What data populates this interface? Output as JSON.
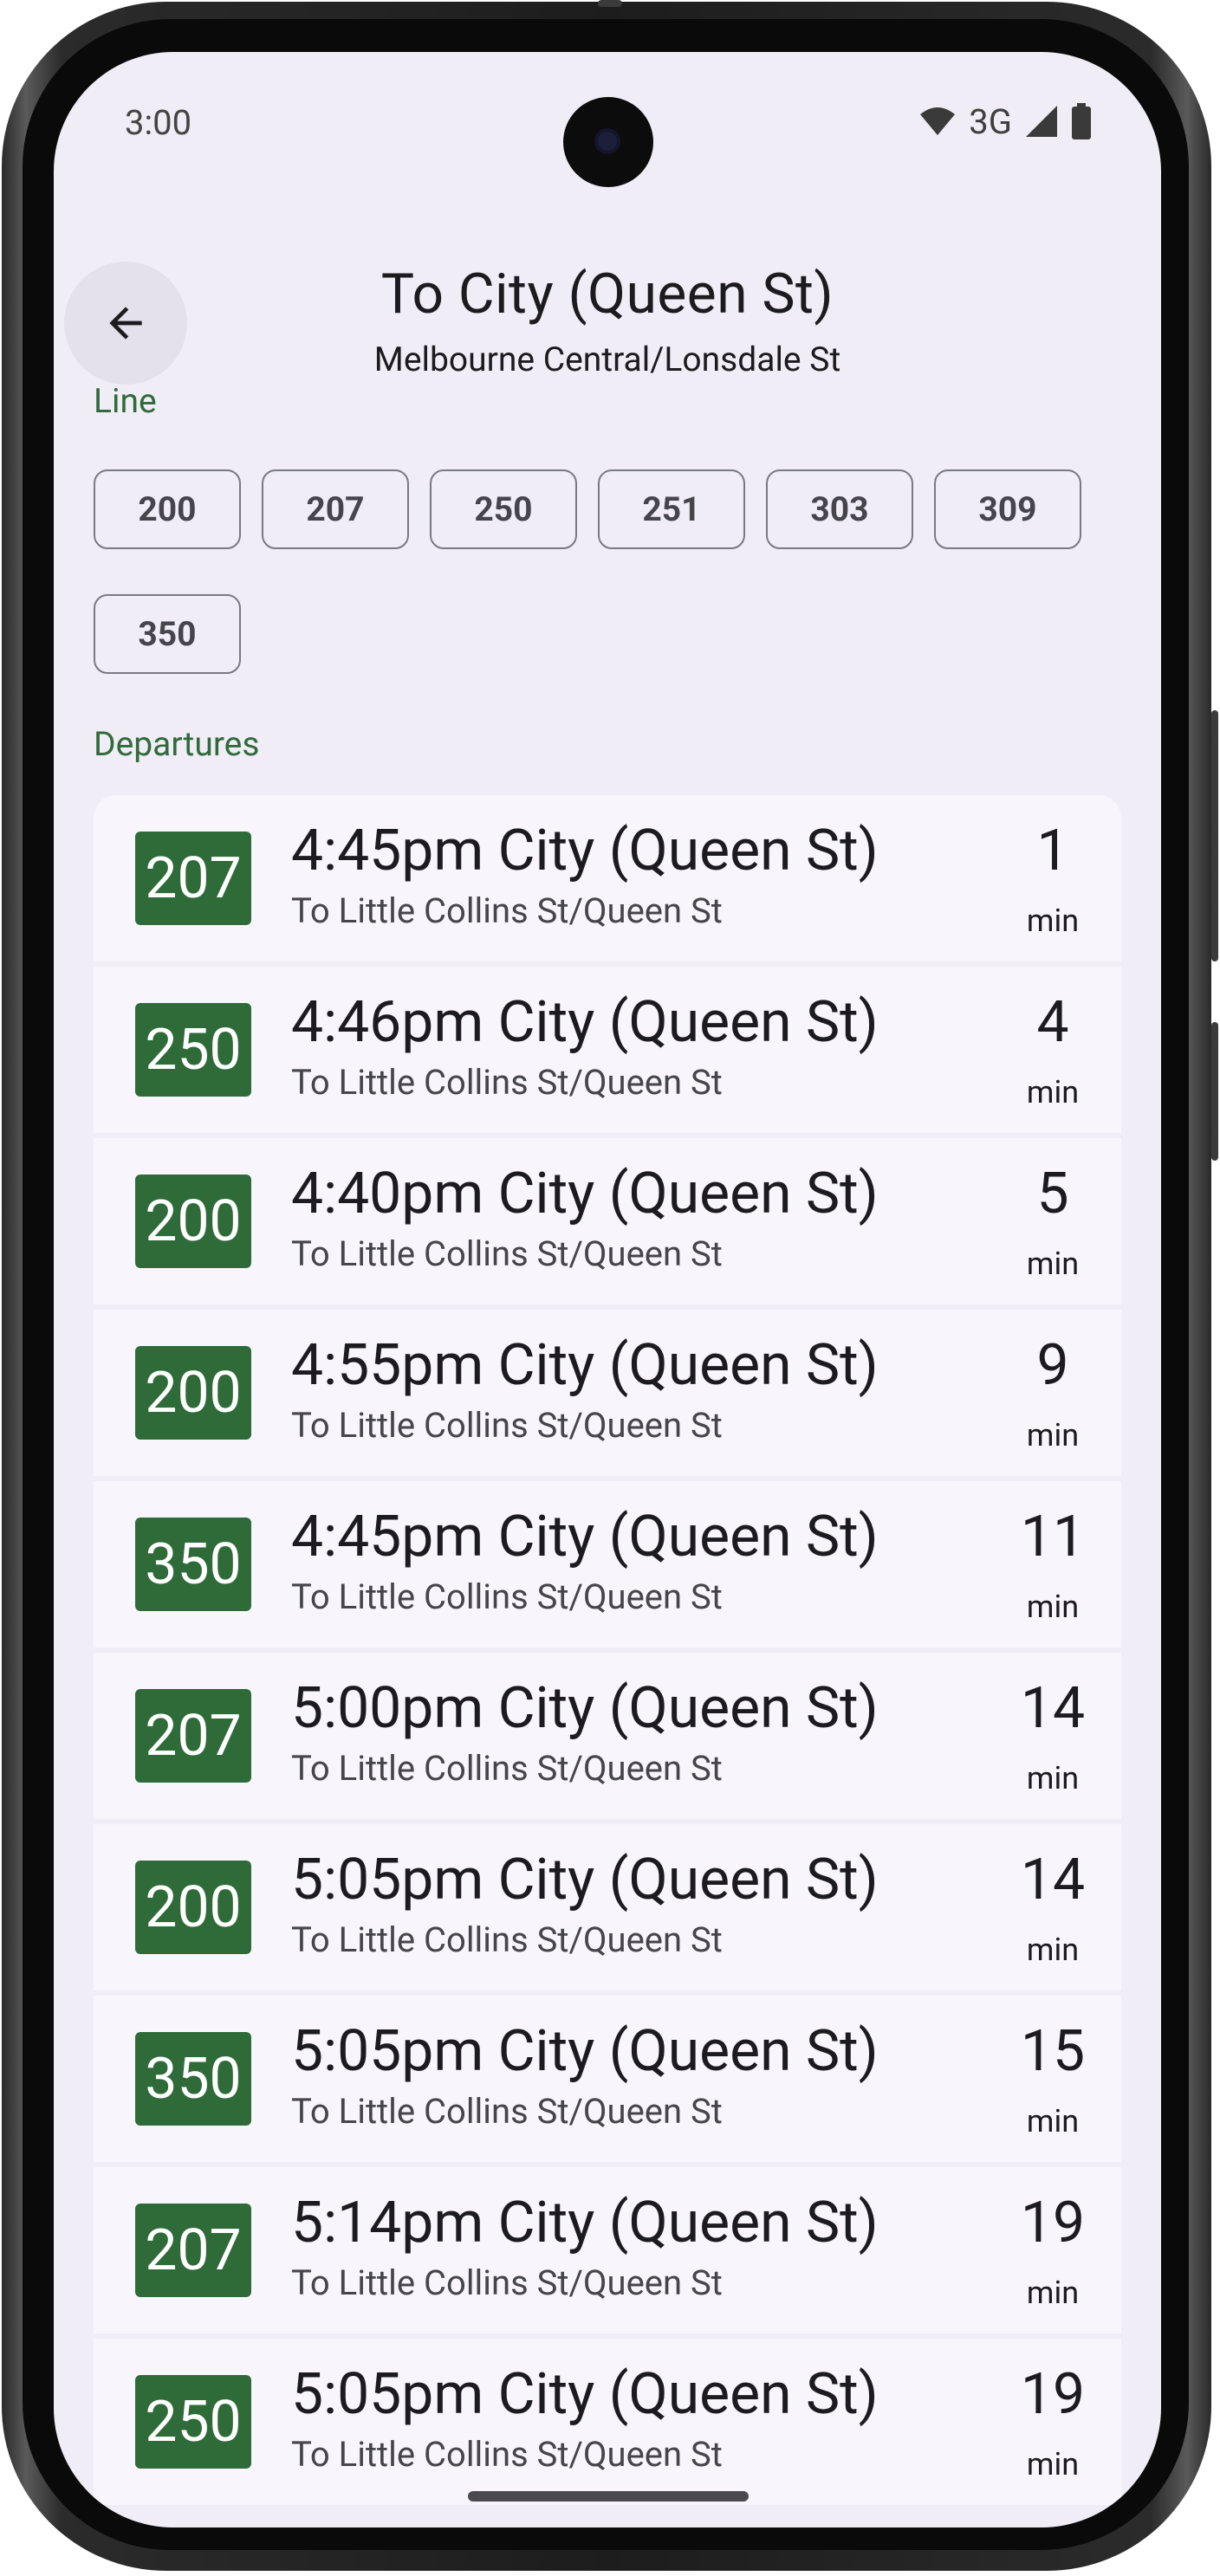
{
  "status_bar": {
    "time": "3:00",
    "network": "3G",
    "icons": [
      "wifi-icon",
      "cell-signal-icon",
      "battery-icon"
    ]
  },
  "header": {
    "back_icon": "arrow-back-icon",
    "title": "To City (Queen St)",
    "subtitle": "Melbourne Central/Lonsdale St"
  },
  "line_filter": {
    "label": "Line",
    "chips": [
      "200",
      "207",
      "250",
      "251",
      "303",
      "309",
      "350"
    ]
  },
  "departures": {
    "label": "Departures",
    "items": [
      {
        "route": "207",
        "title": "4:45pm City (Queen St)",
        "subtitle": "To Little Collins St/Queen St",
        "minutes": "1",
        "unit": "min"
      },
      {
        "route": "250",
        "title": "4:46pm City (Queen St)",
        "subtitle": "To Little Collins St/Queen St",
        "minutes": "4",
        "unit": "min"
      },
      {
        "route": "200",
        "title": "4:40pm City (Queen St)",
        "subtitle": "To Little Collins St/Queen St",
        "minutes": "5",
        "unit": "min"
      },
      {
        "route": "200",
        "title": "4:55pm City (Queen St)",
        "subtitle": "To Little Collins St/Queen St",
        "minutes": "9",
        "unit": "min"
      },
      {
        "route": "350",
        "title": "4:45pm City (Queen St)",
        "subtitle": "To Little Collins St/Queen St",
        "minutes": "11",
        "unit": "min"
      },
      {
        "route": "207",
        "title": "5:00pm City (Queen St)",
        "subtitle": "To Little Collins St/Queen St",
        "minutes": "14",
        "unit": "min"
      },
      {
        "route": "200",
        "title": "5:05pm City (Queen St)",
        "subtitle": "To Little Collins St/Queen St",
        "minutes": "14",
        "unit": "min"
      },
      {
        "route": "350",
        "title": "5:05pm City (Queen St)",
        "subtitle": "To Little Collins St/Queen St",
        "minutes": "15",
        "unit": "min"
      },
      {
        "route": "207",
        "title": "5:14pm City (Queen St)",
        "subtitle": "To Little Collins St/Queen St",
        "minutes": "19",
        "unit": "min"
      },
      {
        "route": "250",
        "title": "5:05pm City (Queen St)",
        "subtitle": "To Little Collins St/Queen St",
        "minutes": "19",
        "unit": "min"
      }
    ]
  },
  "colors": {
    "accent": "#2e6b38",
    "background": "#f0edf6",
    "card": "#f8f6fc"
  }
}
